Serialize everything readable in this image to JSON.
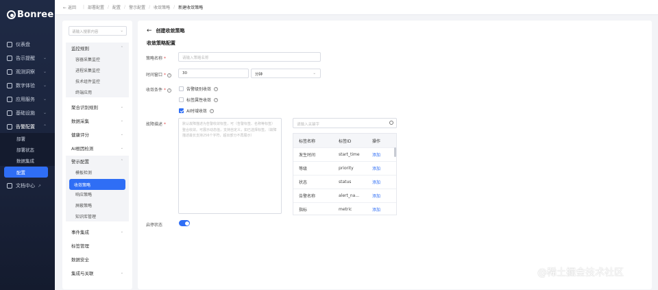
{
  "brand": {
    "logo_text": "Bonree",
    "accent": "#2f6ef5",
    "sidebar_bg": "#1f2a45"
  },
  "sidebar": {
    "items": [
      {
        "label": "仪表盘",
        "icon": "dashboard-icon"
      },
      {
        "label": "告示提醒",
        "icon": "bell-icon"
      },
      {
        "label": "观测洞察",
        "icon": "eye-icon"
      },
      {
        "label": "数字体验",
        "icon": "monitor-icon"
      },
      {
        "label": "应用服务",
        "icon": "app-icon"
      },
      {
        "label": "基础设施",
        "icon": "server-icon"
      },
      {
        "label": "告警配置",
        "icon": "settings-icon"
      }
    ],
    "sub_items": [
      {
        "label": "部署"
      },
      {
        "label": "部署状态"
      },
      {
        "label": "数据集成"
      },
      {
        "label": "配置"
      }
    ],
    "bottom": {
      "label": "文档中心",
      "icon": "doc-icon"
    }
  },
  "breadcrumb": {
    "back": "返回",
    "items": [
      "部署配置",
      "配置",
      "警示配置",
      "收敛策略",
      "新建收敛策略"
    ]
  },
  "menu": {
    "search_placeholder": "请输入搜索内容",
    "groups": [
      {
        "label": "监控规则",
        "children": [
          "容器采集监控",
          "进程采集监控",
          "技术组件监控",
          "终端应用"
        ]
      },
      {
        "label": "聚合识别规则"
      },
      {
        "label": "数据采集"
      },
      {
        "label": "健康评分"
      },
      {
        "label": "AI根因检测"
      },
      {
        "label": "警示配置",
        "children": [
          "模板检测",
          "收敛策略",
          "响应策略",
          "屏蔽策略",
          "知识库管理"
        ]
      },
      {
        "label": "事件集成"
      },
      {
        "label": "标签管理"
      },
      {
        "label": "数据安全"
      },
      {
        "label": "集成与关联"
      }
    ]
  },
  "form": {
    "page_title": "创建收敛策略",
    "section_title": "收敛策略配置",
    "name": {
      "label": "策略名称",
      "placeholder": "请输入策略名称"
    },
    "window": {
      "label": "时间窗口",
      "value": "30",
      "unit": "分钟"
    },
    "condition": {
      "label": "收敛条件",
      "options": [
        {
          "label": "告警级别收敛",
          "checked": false
        },
        {
          "label": "标签属性收敛",
          "checked": false
        },
        {
          "label": "AI时域收敛",
          "checked": true
        }
      ]
    },
    "desc": {
      "label": "故障描述",
      "placeholder": "默认故障描述为告警收敛标签，可（告警标签、名称等标签）整合收敛。可展示动态值，支持自定义，如已选择标签。（故障描述最长支持256个字符，超出部分不再展示）"
    },
    "enable": {
      "label": "启停状态",
      "on": true
    }
  },
  "tags": {
    "search_placeholder": "请输入关键字",
    "columns": [
      "标签名称",
      "标签ID",
      "操作"
    ],
    "rows": [
      {
        "name": "发生时间",
        "id": "start_time",
        "action": "添加"
      },
      {
        "name": "等级",
        "id": "priority",
        "action": "添加"
      },
      {
        "name": "状态",
        "id": "status",
        "action": "添加"
      },
      {
        "name": "告警名称",
        "id": "alert_na...",
        "action": "添加"
      },
      {
        "name": "指标",
        "id": "metric",
        "action": "添加"
      }
    ]
  },
  "watermark": "@稀土掘金技术社区"
}
